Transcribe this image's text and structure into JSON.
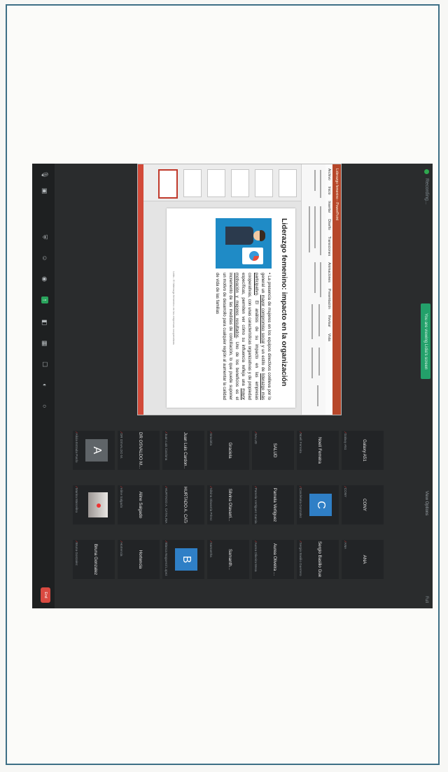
{
  "topbar": {
    "recording_label": "Recording...",
    "share_banner": "You are viewing Lidia's screen",
    "view_label": "View Options",
    "full_label": "Full"
  },
  "ppt": {
    "app_title": "Liderazgo femenino - PowerPoint",
    "tabs": [
      "Archivo",
      "Inicio",
      "Insertar",
      "Diseño",
      "Transiciones",
      "Animaciones",
      "Presentación",
      "Revisar",
      "Vista"
    ],
    "slide": {
      "title": "Liderazgo femenino: impacto en la organización",
      "bullet_1": "La presencia de mujeres en los equipos directivos conlleva por lo general un",
      "bullet_1_u1": "mayor compromiso social",
      "bullet_1_b": "y un estilo de",
      "bullet_1_u2": "liderazgo más participativo",
      "bullet_1_c": ". El análisis de su impacto en las empresas cooperativas, con unas características organizativas y de propiedad específicas, permiten ver cómo su influencia refleja una",
      "bullet_1_u3": "mayor motivación y mejores resultados",
      "bullet_1_d": ". Uno de los beneficios es el incremento de las medidas de conciliación, lo que puede suponer un motivo de desarrollo para cualquier región al aumentar la calidad de vida de las familias",
      "footer": "Lidia - El liderazgo femenino en las empresas cooperativas"
    }
  },
  "participants": [
    {
      "name": "Galaxy A51",
      "label": "Galaxy A51",
      "muted": true
    },
    {
      "name": "CONY",
      "label": "CONY",
      "muted": true
    },
    {
      "name": "ANA",
      "label": "ANA",
      "muted": true
    },
    {
      "name": "Noelí Ferreira",
      "label": "Noelí Ferreira",
      "muted": true
    },
    {
      "name": "",
      "label": "Candelaria Gonzalez",
      "muted": true,
      "avatar": "C"
    },
    {
      "name": "Sergio Basilio Gue...",
      "label": "Sergio Basilio Guerrero",
      "muted": true
    },
    {
      "name": "SALUD",
      "label": "SALUD",
      "muted": true
    },
    {
      "name": "Pamela Vertiguez",
      "label": "Pamela Vertiguez Garcia",
      "muted": true
    },
    {
      "name": "Aurea Oliveira ...",
      "label": "Aurea Oliveira Mesa",
      "muted": true
    },
    {
      "name": "Graciela",
      "label": "Graciela",
      "muted": true
    },
    {
      "name": "Silvina Olavarri...",
      "label": "Silvina Olavarria Pérez",
      "muted": true
    },
    {
      "name": "Samanth...",
      "label": "Samantha",
      "muted": true
    },
    {
      "name": "Juan Luis Cardon...",
      "label": "Juan Luis Cardona",
      "muted": true
    },
    {
      "name": "HURTADO A. CATAL...",
      "label": "HURTADO A. CATALINA",
      "muted": true
    },
    {
      "name": "",
      "label": "Blanca Noguerol Lopez",
      "muted": true,
      "avatar": "B"
    },
    {
      "name": "DR OSVALDO M...",
      "label": "DR OSVALDO M.",
      "muted": true
    },
    {
      "name": "Aline Salgado",
      "label": "Aline Salgado",
      "muted": true
    },
    {
      "name": "Hortencia",
      "label": "Hortencia",
      "muted": true
    },
    {
      "name": "",
      "label": "Alicia Estrada Pardo",
      "muted": true,
      "avatar": "A"
    },
    {
      "name": "",
      "label": "Marina Marcelino",
      "muted": true,
      "photo": true
    },
    {
      "name": "Bruna Gonzalez",
      "label": "Bruna Gonzalez",
      "muted": true
    }
  ],
  "toolbar": {
    "end_label": "End"
  }
}
